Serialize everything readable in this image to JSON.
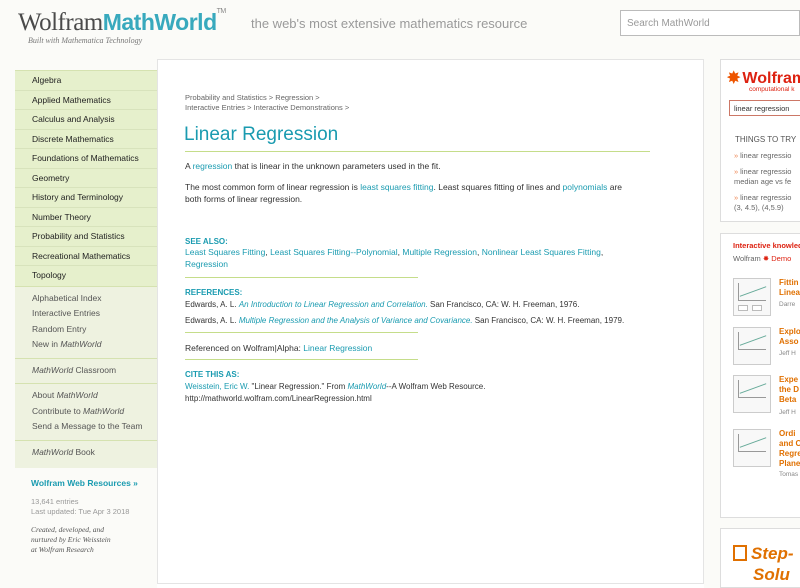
{
  "header": {
    "logo_wolfram": "Wolfram",
    "logo_mathworld": "MathWorld",
    "tm": "TM",
    "tagline": "the web's most extensive mathematics resource",
    "built_with": "Built with Mathematica Technology",
    "search_placeholder": "Search MathWorld"
  },
  "sidebar": {
    "topics": [
      "Algebra",
      "Applied Mathematics",
      "Calculus and Analysis",
      "Discrete Mathematics",
      "Foundations of Mathematics",
      "Geometry",
      "History and Terminology",
      "Number Theory",
      "Probability and Statistics",
      "Recreational Mathematics",
      "Topology"
    ],
    "index_links": [
      "Alphabetical Index",
      "Interactive Entries",
      "Random Entry",
      "New in ",
      "MathWorld"
    ],
    "classroom_italic": "MathWorld",
    "classroom": " Classroom",
    "about": "About ",
    "about_italic": "MathWorld",
    "contribute": "Contribute to ",
    "contribute_italic": "MathWorld",
    "send_message": "Send a Message to the Team",
    "book_italic": "MathWorld",
    "book": " Book",
    "web_resources": "Wolfram Web Resources »",
    "entries": "13,641 entries",
    "last_updated": "Last updated: Tue Apr 3 2018",
    "credits_1": "Created, developed, and",
    "credits_2": "nurtured by Eric Weisstein",
    "credits_3": "at Wolfram Research"
  },
  "breadcrumb": {
    "line1_a": "Probability and Statistics",
    "line1_sep": " > ",
    "line1_b": "Regression",
    "line1_end": " >",
    "line2_a": "Interactive Entries",
    "line2_sep": " > ",
    "line2_b": "Interactive Demonstrations",
    "line2_end": " >"
  },
  "article": {
    "title": "Linear Regression",
    "p1_a": "A ",
    "p1_link": "regression",
    "p1_b": " that is linear in the unknown parameters used in the fit.",
    "p2_a": "The most common form of linear regression is ",
    "p2_link1": "least squares fitting",
    "p2_b": ". Least squares fitting of lines and ",
    "p2_link2": "polynomials",
    "p2_c": " are",
    "p2_d": "both forms of linear regression.",
    "see_also_heading": "SEE ALSO:",
    "see_also": [
      "Least Squares Fitting",
      "Least Squares Fitting--Polynomial",
      "Multiple Regression",
      "Nonlinear Least Squares Fitting"
    ],
    "see_also_last": "Regression",
    "references_heading": "REFERENCES:",
    "ref1_a": "Edwards, A. L. ",
    "ref1_title": "An Introduction to Linear Regression and Correlation.",
    "ref1_b": " San Francisco, CA: W. H. Freeman, 1976.",
    "ref2_a": "Edwards, A. L. ",
    "ref2_title": "Multiple Regression and the Analysis of Variance and Covariance.",
    "ref2_b": " San Francisco, CA: W. H. Freeman, 1979.",
    "referenced_on": "Referenced on Wolfram|Alpha: ",
    "referenced_link": "Linear Regression",
    "cite_heading": "CITE THIS AS:",
    "cite_author": "Weisstein, Eric W.",
    "cite_a": " \"Linear Regression.\" From ",
    "cite_mw": "MathWorld",
    "cite_b": "--A Wolfram Web Resource.",
    "cite_url": "http://mathworld.wolfram.com/LinearRegression.html"
  },
  "rightcol": {
    "wa_logo": "Wolfram",
    "wa_sub": "computational k",
    "wa_input": "linear regression",
    "things_to_try": "THINGS TO TRY",
    "try1": "linear regressio",
    "try2a": "linear regressio",
    "try2b": "median age vs fe",
    "try3a": "linear regressio",
    "try3b": "(3, 4.5), (4,5.9)",
    "ik_title": "Interactive knowled",
    "ik_wolfram": "Wolfram ",
    "ik_demo": "Demo",
    "demos": [
      {
        "t1": "Fittin",
        "t2": "Linea",
        "t3": "",
        "t4": "",
        "author": "Darre"
      },
      {
        "t1": "Explo",
        "t2": "Asso",
        "t3": "",
        "t4": "",
        "author": "Jeff H"
      },
      {
        "t1": "Expe",
        "t2": "the D",
        "t3": "Beta",
        "t4": "",
        "author": "Jeff H"
      },
      {
        "t1": "Ordi",
        "t2": "and O",
        "t3": "Regre",
        "t4": "Plane",
        "author": "Tomas"
      }
    ],
    "step_line1": "Step-",
    "step_line2": "Solu"
  }
}
